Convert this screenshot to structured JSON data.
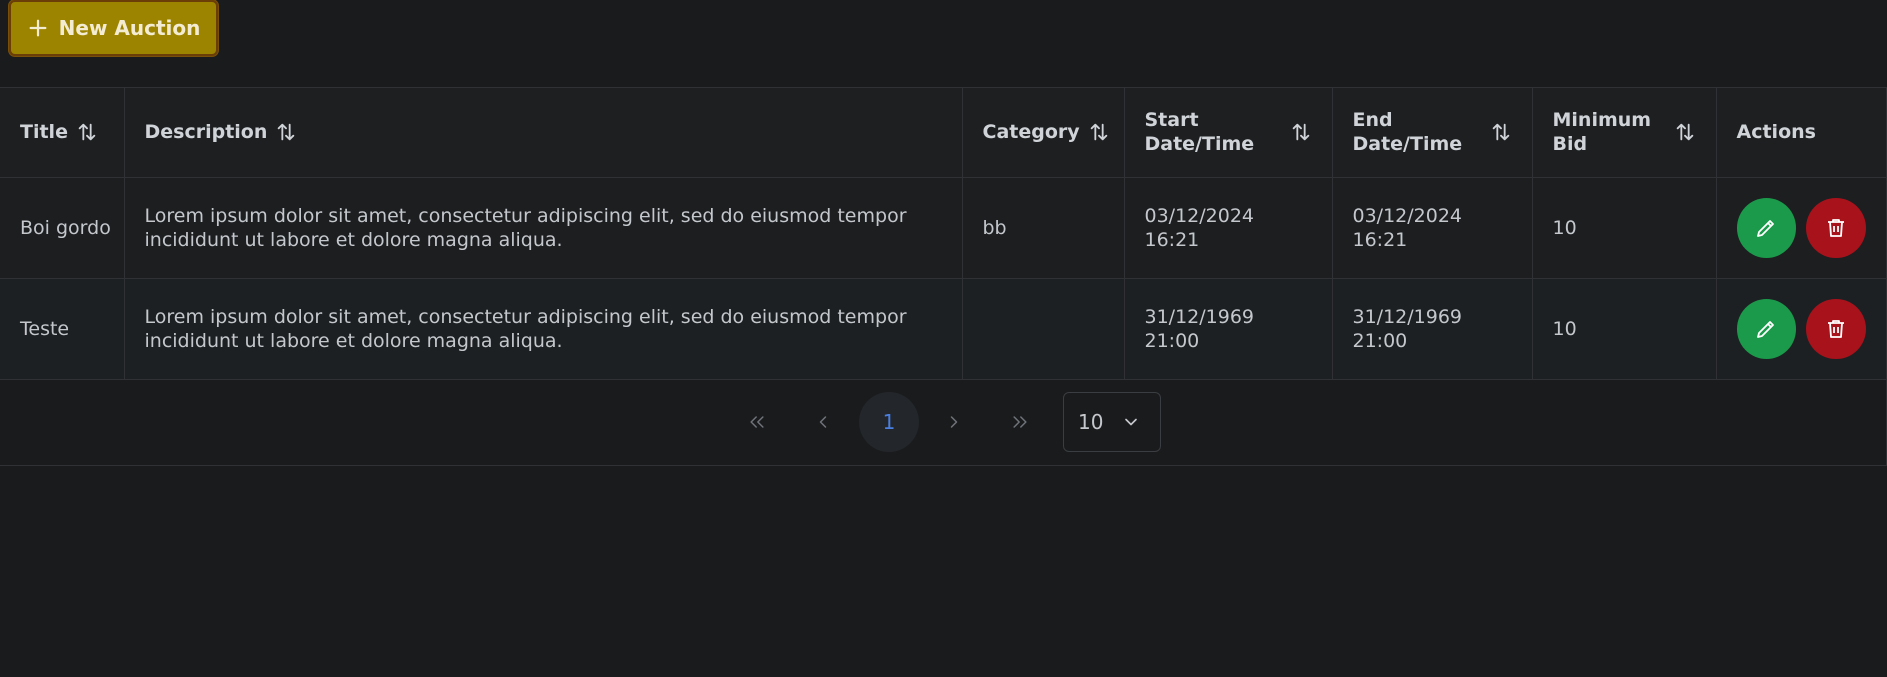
{
  "toolbar": {
    "new_auction_label": "New Auction"
  },
  "table": {
    "columns": [
      {
        "label": "Title",
        "sortable": true
      },
      {
        "label": "Description",
        "sortable": true
      },
      {
        "label": "Category",
        "sortable": true
      },
      {
        "label": "Start Date/Time",
        "sortable": true
      },
      {
        "label": "End Date/Time",
        "sortable": true
      },
      {
        "label": "Minimum Bid",
        "sortable": true
      },
      {
        "label": "Actions",
        "sortable": false
      }
    ],
    "rows": [
      {
        "title": "Boi gordo",
        "description": "Lorem ipsum dolor sit amet, consectetur adipiscing elit, sed do eiusmod tempor incididunt ut labore et dolore magna aliqua.",
        "category": "bb",
        "start": "03/12/2024 16:21",
        "end": "03/12/2024 16:21",
        "min_bid": "10"
      },
      {
        "title": "Teste",
        "description": "Lorem ipsum dolor sit amet, consectetur adipiscing elit, sed do eiusmod tempor incididunt ut labore et dolore magna aliqua.",
        "category": "",
        "start": "31/12/1969 21:00",
        "end": "31/12/1969 21:00",
        "min_bid": "10"
      }
    ]
  },
  "pagination": {
    "current_page": "1",
    "page_size": "10",
    "icons": [
      "double-chevron-left-icon",
      "chevron-left-icon",
      "chevron-right-icon",
      "double-chevron-right-icon",
      "chevron-down-icon"
    ]
  },
  "colors": {
    "background": "#1a1b1d",
    "new_button": "#9c8400",
    "edit_button": "#1a9a4a",
    "delete_button": "#a8121b",
    "active_page": "#4a7fe0"
  }
}
